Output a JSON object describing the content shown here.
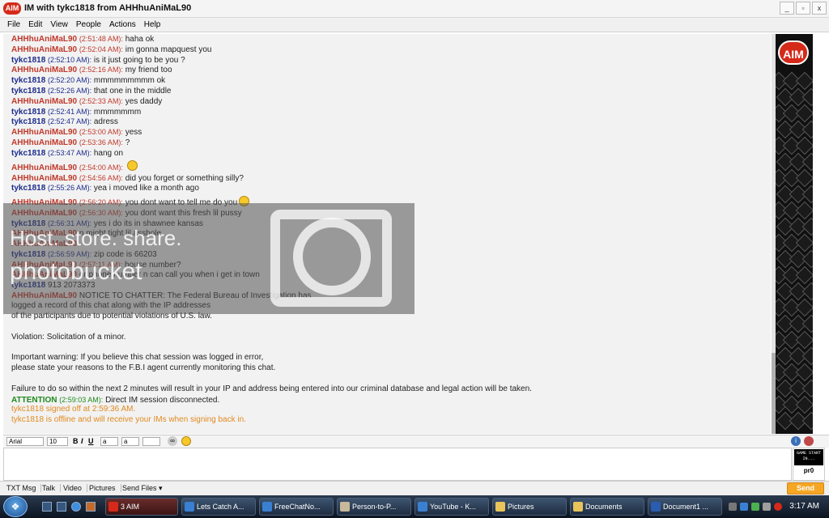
{
  "window": {
    "title": "IM with tykc1818 from AHHhuAniMaL90",
    "logo_text": "AIM",
    "controls": [
      "_",
      "▫",
      "x"
    ]
  },
  "menu": [
    "File",
    "Edit",
    "View",
    "People",
    "Actions",
    "Help"
  ],
  "chat": {
    "lines": [
      {
        "sn": "AHHhuAniMaL90",
        "ts": "(2:51:48 AM):",
        "msg": "haha ok",
        "who": "red"
      },
      {
        "sn": "AHHhuAniMaL90",
        "ts": "(2:52:04 AM):",
        "msg": "im gonna mapquest you",
        "who": "red"
      },
      {
        "sn": "tykc1818",
        "ts": "(2:52:10 AM):",
        "msg": "is it just going to be you ?",
        "who": "blue"
      },
      {
        "sn": "AHHhuAniMaL90",
        "ts": "(2:52:16 AM):",
        "msg": "my friend too",
        "who": "red"
      },
      {
        "sn": "tykc1818",
        "ts": "(2:52:20 AM):",
        "msg": "mmmmmmmmm ok",
        "who": "blue"
      },
      {
        "sn": "tykc1818",
        "ts": "(2:52:26 AM):",
        "msg": "that one in the middle",
        "who": "blue"
      },
      {
        "sn": "AHHhuAniMaL90",
        "ts": "(2:52:33 AM):",
        "msg": "yes daddy",
        "who": "red"
      },
      {
        "sn": "tykc1818",
        "ts": "(2:52:41 AM):",
        "msg": "mmmmmmm",
        "who": "blue"
      },
      {
        "sn": "tykc1818",
        "ts": "(2:52:47 AM):",
        "msg": "adress",
        "who": "blue"
      },
      {
        "sn": "AHHhuAniMaL90",
        "ts": "(2:53:00 AM):",
        "msg": "yess",
        "who": "red"
      },
      {
        "sn": "AHHhuAniMaL90",
        "ts": "(2:53:36 AM):",
        "msg": "?",
        "who": "red"
      },
      {
        "sn": "tykc1818",
        "ts": "(2:53:47 AM):",
        "msg": "hang on",
        "who": "blue"
      },
      {
        "sn": "AHHhuAniMaL90",
        "ts": "(2:54:00 AM):",
        "msg": "",
        "who": "red",
        "emoticon": true,
        "tall": true
      },
      {
        "sn": "AHHhuAniMaL90",
        "ts": "(2:54:56 AM):",
        "msg": "did you forget or something silly?",
        "who": "red"
      },
      {
        "sn": "tykc1818",
        "ts": "(2:55:26 AM):",
        "msg": "yea i moved like a month ago",
        "who": "blue"
      },
      {
        "sn": "AHHhuAniMaL90",
        "ts": "(2:56:20 AM):",
        "msg": "you dont want to tell me do you",
        "who": "red",
        "emoticon": true,
        "tall": true
      },
      {
        "sn": "AHHhuAniMaL90",
        "ts": "(2:56:30 AM):",
        "msg": "you dont want this fresh lil pussy",
        "who": "red"
      },
      {
        "sn": "tykc1818",
        "ts": "(2:56:31 AM):",
        "msg": "yes i do its in shawnee kansas",
        "who": "blue"
      },
      {
        "sn": "AHHhuAniMaL90",
        "ts": "",
        "msg": "n might tight lil asshole",
        "who": "red"
      },
      {
        "sn": "AHHhuAniMaL90",
        "ts": "",
        "msg": "",
        "who": "red"
      },
      {
        "sn": "tykc1818",
        "ts": "(2:56:59 AM):",
        "msg": "zip code is 66203",
        "who": "blue"
      },
      {
        "sn": "AHHhuAniMaL90",
        "ts": "(2:57:11 AM):",
        "msg": "house number?",
        "who": "red"
      },
      {
        "sn": "AHHhuAniMaL90",
        "ts": "",
        "msg": "or phone number n can call you when i get in town",
        "who": "red"
      },
      {
        "sn": "tykc1818",
        "ts": "",
        "msg": "913 2073373",
        "who": "blue"
      },
      {
        "sn": "AHHhuAniMaL90",
        "ts": "",
        "msg": "NOTICE TO CHATTER: The Federal Bureau of Investigation has",
        "who": "red"
      },
      {
        "plain": "logged a record of this chat along with the IP addresses"
      },
      {
        "plain": "of the participants due to potential violations of U.S. law."
      },
      {
        "blank": true
      },
      {
        "plain": "Violation: Solicitation of a minor."
      },
      {
        "blank": true
      },
      {
        "plain": "Important warning: If you believe this chat session was logged in error,"
      },
      {
        "plain": "please state your reasons to the F.B.I agent currently monitoring this chat."
      },
      {
        "blank": true
      },
      {
        "plain": "Failure to do so within the next 2 minutes will result in your IP and address being entered into our criminal database and legal action will be taken."
      },
      {
        "sn": "ATTENTION",
        "ts": "(2:59:03 AM):",
        "msg": "Direct IM session disconnected.",
        "who": "green"
      },
      {
        "sys": "tykc1818 signed off at 2:59:36 AM."
      },
      {
        "sys": "tykc1818 is offline and will receive your IMs when signing back in."
      }
    ]
  },
  "watermark": {
    "line1": "Host. store. share.",
    "line2": "photobucket"
  },
  "banner": {
    "badge": "AIM"
  },
  "format_bar": {
    "font": "Arial",
    "size": "10",
    "bold": "B",
    "italic": "I",
    "underline": "U"
  },
  "game_box": {
    "screen_text": "GAME START IN...",
    "caption": "pr0"
  },
  "actions": {
    "buttons": [
      "TXT Msg",
      "Talk",
      "Video",
      "Pictures",
      "Send Files ▾"
    ],
    "send": "Send"
  },
  "taskbar": {
    "tasks": [
      {
        "label": "3 AIM",
        "color": "#d52a1a",
        "active": true
      },
      {
        "label": "Lets Catch A...",
        "color": "#3a80d2"
      },
      {
        "label": "FreeChatNo...",
        "color": "#3a80d2"
      },
      {
        "label": "Person-to-P...",
        "color": "#c8b89a"
      },
      {
        "label": "YouTube - K...",
        "color": "#3a80d2"
      },
      {
        "label": "Pictures",
        "color": "#e8c45a"
      },
      {
        "label": "Documents",
        "color": "#e8c45a"
      },
      {
        "label": "Document1 ...",
        "color": "#2a5db0"
      }
    ],
    "clock": "3:17 AM"
  }
}
